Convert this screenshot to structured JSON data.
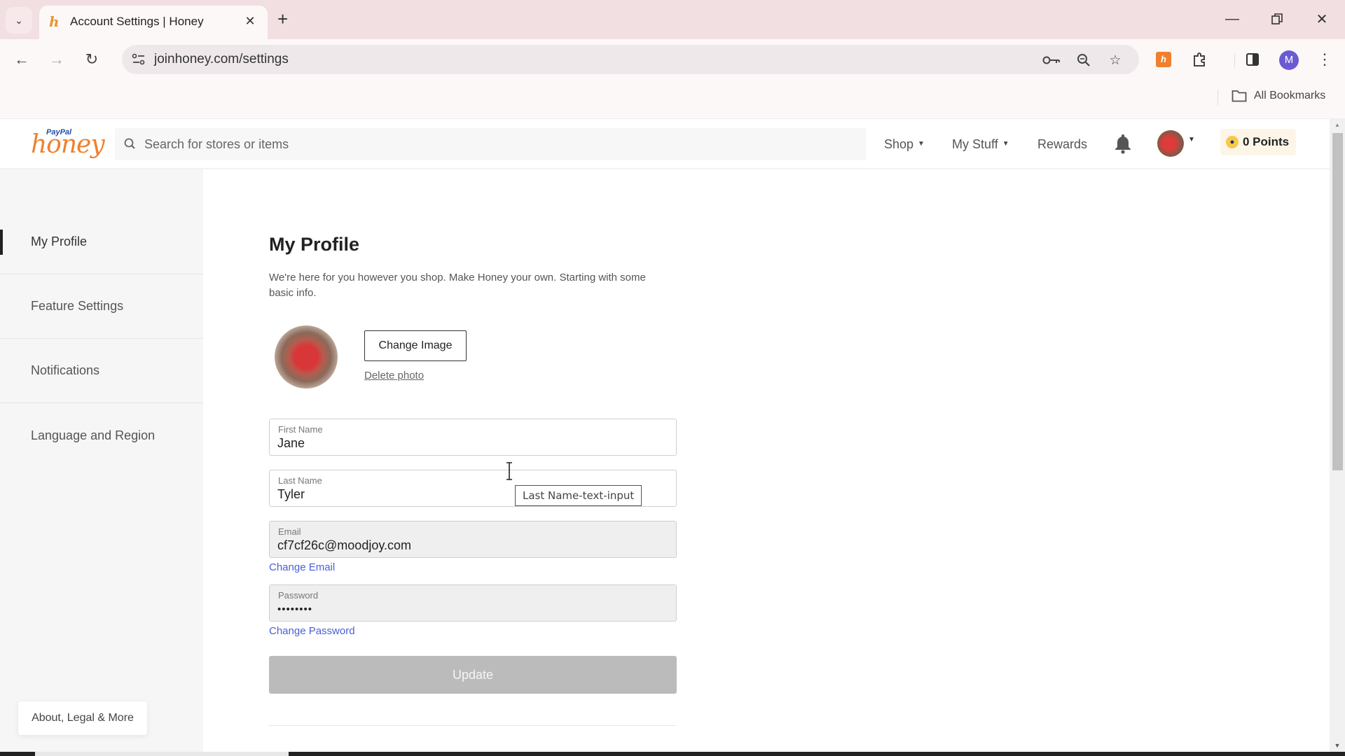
{
  "browser": {
    "tab_title": "Account Settings | Honey",
    "url": "joinhoney.com/settings",
    "bookmarks_label": "All Bookmarks",
    "profile_initial": "M",
    "colors": {
      "tab_strip": "#f1dfe2",
      "profile_avatar": "#6b5bd3",
      "honey_extension": "#f0802e"
    }
  },
  "header": {
    "logo_small": "PayPal",
    "logo_main": "honey",
    "search_placeholder": "Search for stores or items",
    "nav": [
      {
        "label": "Shop",
        "has_dropdown": true
      },
      {
        "label": "My Stuff",
        "has_dropdown": true
      },
      {
        "label": "Rewards",
        "has_dropdown": false
      }
    ],
    "points_label": "0 Points"
  },
  "sidebar": {
    "items": [
      {
        "label": "My Profile",
        "active": true
      },
      {
        "label": "Feature Settings",
        "active": false
      },
      {
        "label": "Notifications",
        "active": false
      },
      {
        "label": "Language and Region",
        "active": false
      }
    ],
    "footer_button": "About, Legal & More"
  },
  "profile": {
    "title": "My Profile",
    "description": "We're here for you however you shop. Make Honey your own. Starting with some basic info.",
    "change_image_label": "Change Image",
    "delete_photo_label": "Delete photo",
    "fields": {
      "first_name": {
        "label": "First Name",
        "value": "Jane"
      },
      "last_name": {
        "label": "Last Name",
        "value": "Tyler"
      },
      "email": {
        "label": "Email",
        "value": "cf7cf26c@moodjoy.com"
      },
      "password": {
        "label": "Password",
        "value": "••••••••"
      }
    },
    "change_email_label": "Change Email",
    "change_password_label": "Change Password",
    "update_label": "Update",
    "tooltip": "Last Name-text-input",
    "link_color": "#4a5fd6"
  }
}
